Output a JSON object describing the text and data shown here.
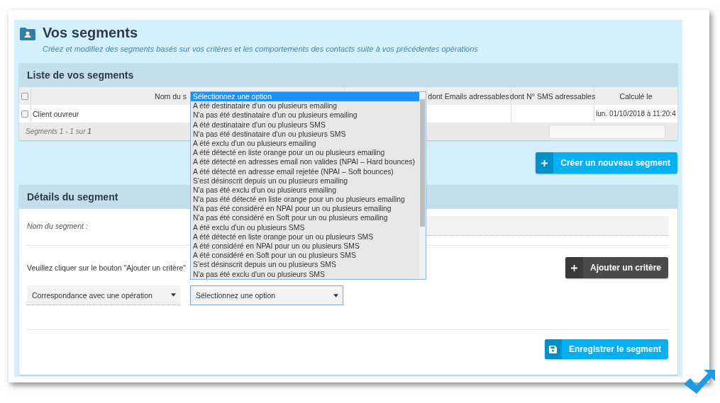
{
  "page": {
    "title": "Vos segments",
    "subtitle": "Créez et modifiez des segments basés sur vos critères et les comportements des contacts suite à vos précédentes opérations"
  },
  "segments_list": {
    "title": "Liste de vos segments",
    "all_checked": false,
    "columns": [
      {
        "label": "Nom du s"
      },
      {},
      {
        "label": "dont Emails adressables"
      },
      {
        "label": "dont N° SMS adressables"
      },
      {
        "label": "Calculé le"
      }
    ],
    "rows": [
      {
        "checked": false,
        "cells": [
          "Client ouvreur",
          "",
          "",
          "",
          "lun. 01/10/2018 à 11:20:4"
        ]
      }
    ],
    "footer": "Segments 1 - 1 sur **1**"
  },
  "create_button": "Créer un nouveau segment",
  "details": {
    "title": "Détails du segment",
    "name_label": "Nom du segment :",
    "instruction": "Veuillez cliquer sur le bouton \"Ajouter un critère\"",
    "add_button": "Ajouter un critère",
    "match_select": "Correspondance avec une opération",
    "option_select": "Sélectionnez une option",
    "save_button": "Enregistrer le segment"
  },
  "dropdown": {
    "options": [
      {
        "label": "Sélectionnez une option",
        "selected": true
      },
      {
        "label": "A été destinataire d'un ou plusieurs emailing",
        "selected": false
      },
      {
        "label": "N'a pas été destinataire d'un ou plusieurs emailing",
        "selected": false
      },
      {
        "label": "A été destinataire d'un ou plusieurs SMS",
        "selected": false
      },
      {
        "label": "N'a pas été destinataire d'un ou plusieurs SMS",
        "selected": false
      },
      {
        "label": "A été exclu d'un ou plusieurs emailing",
        "selected": false
      },
      {
        "label": "A été détecté en liste orange pour un ou plusieurs emailing",
        "selected": false
      },
      {
        "label": "A été détecté en adresses email non valides (NPAI – Hard bounces)",
        "selected": false
      },
      {
        "label": "A été détecté en adresse email rejetée (NPAI – Soft bounces)",
        "selected": false
      },
      {
        "label": "S'est désinscrit depuis un ou plusieurs emailing",
        "selected": false
      },
      {
        "label": "N'a pas été exclu d'un ou plusieurs emailing",
        "selected": false
      },
      {
        "label": "N'a pas été détecté en liste orange pour un ou plusieurs emailing",
        "selected": false
      },
      {
        "label": "N'a pas été considéré en NPAI pour un ou plusieurs emailing",
        "selected": false
      },
      {
        "label": "N'a pas été considéré en Soft pour un ou plusieurs emailing",
        "selected": false
      },
      {
        "label": "A été exclu d'un ou plusieurs SMS",
        "selected": false
      },
      {
        "label": "A été détecté en liste orange pour un ou plusieurs SMS",
        "selected": false
      },
      {
        "label": "A été considéré en NPAI pour un ou plusieurs SMS",
        "selected": false
      },
      {
        "label": "A été considéré en Soft pour un ou plusieurs SMS",
        "selected": false
      },
      {
        "label": "S'est désinscrit depuis un ou plusieurs SMS",
        "selected": false
      },
      {
        "label": "N'a pas été exclu d'un ou plusieurs SMS",
        "selected": false
      }
    ]
  }
}
